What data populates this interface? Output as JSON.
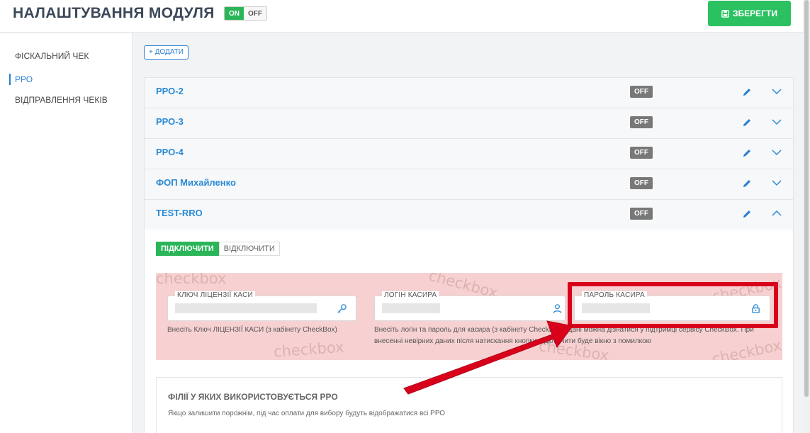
{
  "header": {
    "title": "НАЛАШТУВАННЯ МОДУЛЯ",
    "toggle_on": "ON",
    "toggle_off": "OFF",
    "save_label": "ЗБЕРЕГТИ"
  },
  "sidebar": {
    "items": [
      {
        "label": "ФІСКАЛЬНИЙ ЧЕК"
      },
      {
        "label": "РРО"
      },
      {
        "label": "ВІДПРАВЛЕННЯ ЧЕКІВ"
      }
    ]
  },
  "main": {
    "add_label": "+ ДОДАТИ",
    "rro_rows": [
      {
        "name": "РРО-2",
        "status": "OFF"
      },
      {
        "name": "РРО-3",
        "status": "OFF"
      },
      {
        "name": "РРО-4",
        "status": "OFF"
      },
      {
        "name": "ФОП Михайленко",
        "status": "OFF"
      },
      {
        "name": "TEST-RRO",
        "status": "OFF"
      }
    ],
    "connect_label": "ПІДКЛЮЧИТИ",
    "disconnect_label": "ВІДКЛЮЧИТИ",
    "watermark": "checkbox",
    "fields": {
      "license_key": {
        "label": "КЛЮЧ ЛІЦЕНЗІЇ КАСИ",
        "hint": "Внесіть Ключ ЛІЦЕНЗІЇ КАСИ (з кабінету CheckBox)"
      },
      "cashier_login": {
        "label": "ЛОГІН КАСИРА",
        "hint": "Внесіть логін та пароль для касира (з кабінету CheckBox). Дані можна дізнатися у підтримці сервісу CheckBox. При внесенні невірних даних після натискання кнопки підключити буде вікно з помилкою"
      },
      "cashier_password": {
        "label": "ПАРОЛЬ КАСИРА"
      }
    },
    "filials": {
      "title": "ФІЛІЇ У ЯКИХ ВИКОРИСТОВУЄТЬСЯ РРО",
      "note": "Якщо залишити порожнім, під час оплати для вибору будуть відображатися всі РРО"
    }
  },
  "colors": {
    "accent": "#2a8ad4",
    "success": "#2bc161",
    "annotation": "#d9001b"
  }
}
